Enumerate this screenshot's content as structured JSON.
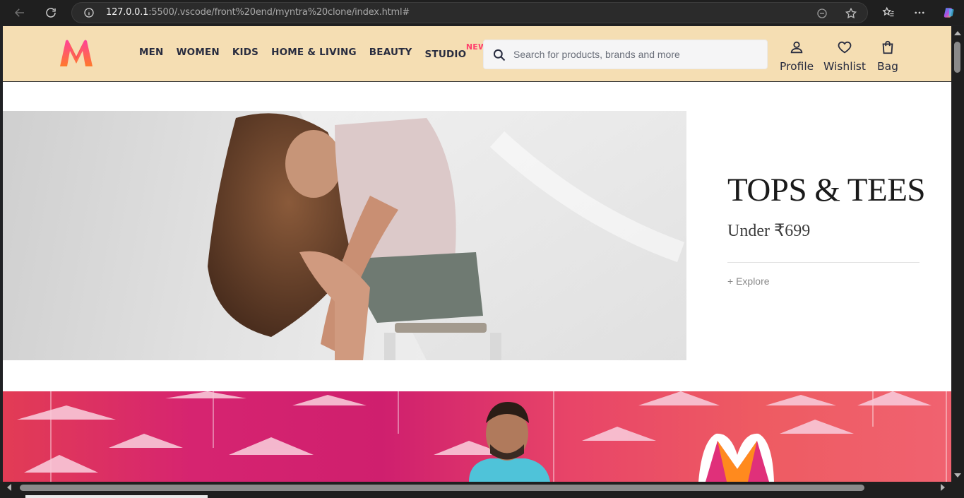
{
  "browser": {
    "url_host": "127.0.0.1",
    "url_rest": ":5500/.vscode/front%20end/myntra%20clone/index.html#"
  },
  "header": {
    "menu": [
      {
        "label": "MEN"
      },
      {
        "label": "WOMEN"
      },
      {
        "label": "KIDS"
      },
      {
        "label": "HOME & LIVING"
      },
      {
        "label": "BEAUTY"
      },
      {
        "label": "STUDIO",
        "badge": "NEW"
      }
    ],
    "search_placeholder": "Search for products, brands and more",
    "actions": {
      "profile": "Profile",
      "wishlist": "Wishlist",
      "bag": "Bag"
    },
    "background_color": "#f5deb3",
    "accent_color": "#ff3f6c"
  },
  "hero": {
    "title": "TOPS & TEES",
    "subtitle": "Under ₹699",
    "cta": "+ Explore"
  },
  "icons": [
    "back-icon",
    "reload-icon",
    "info-icon",
    "reader-icon",
    "star-icon",
    "favorites-icon",
    "more-icon",
    "copilot-icon",
    "search-icon",
    "profile-icon",
    "heart-icon",
    "bag-icon"
  ]
}
